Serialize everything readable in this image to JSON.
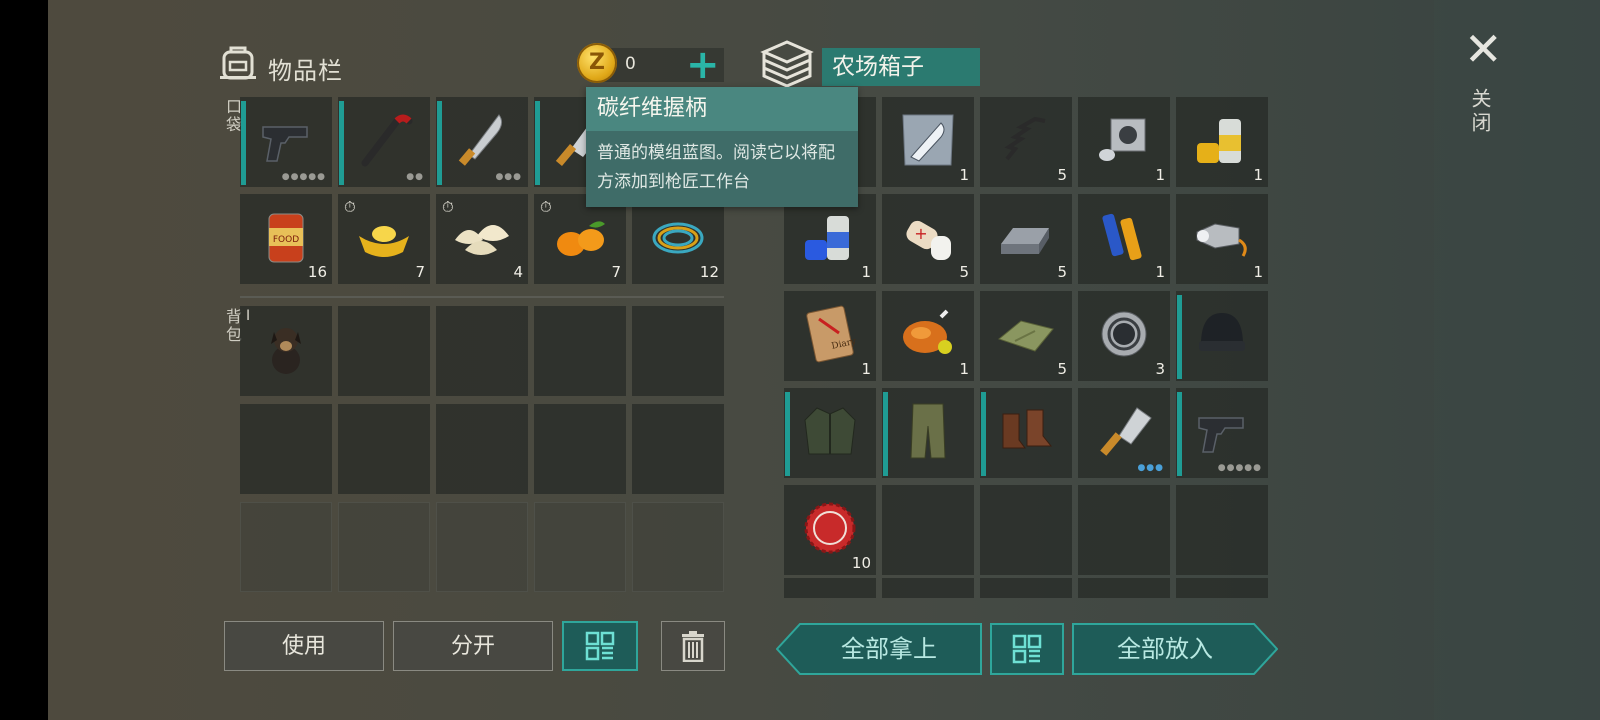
{
  "inventory": {
    "title": "物品栏",
    "pocket_label": "口袋",
    "backpack_label": "背包"
  },
  "currency": {
    "symbol": "Z",
    "amount": "0",
    "add_label": "+"
  },
  "chest": {
    "title": "农场箱子"
  },
  "close": {
    "label": "关闭"
  },
  "tooltip": {
    "title": "碳纤维握柄",
    "description": "普通的模组蓝图。阅读它以将配方添加到枪匠工作台"
  },
  "pocket_items": [
    {
      "name": "pistol",
      "count": "",
      "equipped": true,
      "dots": "●●●●●"
    },
    {
      "name": "crowbar",
      "count": "",
      "equipped": true,
      "dots": "●●"
    },
    {
      "name": "machete",
      "count": "",
      "equipped": true,
      "dots": "●●●"
    },
    {
      "name": "cleaver",
      "count": "",
      "equipped": true,
      "dots": ""
    },
    {
      "name": "canned-food",
      "count": "16"
    },
    {
      "name": "gold-ingot",
      "count": "7"
    },
    {
      "name": "dumplings",
      "count": "4"
    },
    {
      "name": "kumquats",
      "count": "7"
    },
    {
      "name": "rope-coil",
      "count": "12"
    }
  ],
  "backpack_items": [
    {
      "name": "puppy",
      "badge": "I"
    }
  ],
  "chest_items": [
    {
      "name": "blueprint",
      "count": "1"
    },
    {
      "name": "spring",
      "count": "5"
    },
    {
      "name": "engine-cylinder",
      "count": "1"
    },
    {
      "name": "yellow-paint",
      "count": "1"
    },
    {
      "name": "blue-paint",
      "count": "1"
    },
    {
      "name": "bandage",
      "count": "5"
    },
    {
      "name": "metal-ingot",
      "count": "5"
    },
    {
      "name": "batteries",
      "count": "1"
    },
    {
      "name": "flashlight",
      "count": "1"
    },
    {
      "name": "diary",
      "count": "1"
    },
    {
      "name": "roast-chicken",
      "count": "1"
    },
    {
      "name": "cloth",
      "count": "5"
    },
    {
      "name": "bearing",
      "count": "3"
    },
    {
      "name": "beanie",
      "count": ""
    },
    {
      "name": "jacket",
      "count": ""
    },
    {
      "name": "cargo-pants",
      "count": ""
    },
    {
      "name": "boots",
      "count": ""
    },
    {
      "name": "cleaver",
      "count": ""
    },
    {
      "name": "pistol",
      "count": ""
    },
    {
      "name": "bottle-cap",
      "count": "10"
    }
  ],
  "buttons": {
    "use": "使用",
    "split": "分开",
    "take_all": "全部拿上",
    "put_all": "全部放入"
  },
  "colors": {
    "accent": "#2fa69b",
    "tooltip_bg": "#3f6c68",
    "chest_title_bg": "#2b7a70"
  }
}
